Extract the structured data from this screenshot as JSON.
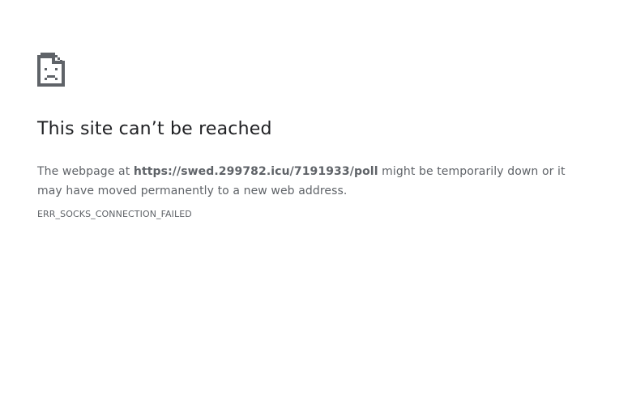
{
  "colors": {
    "title": "#202124",
    "body_text": "#5f6368",
    "icon": "#5f6368",
    "background": "#ffffff"
  },
  "icon": {
    "name": "sad-page-icon"
  },
  "error": {
    "title": "This site can’t be reached",
    "message_prefix": "The webpage at ",
    "url": "https://swed.299782.icu/7191933/poll",
    "message_suffix": " might be temporarily down or it may have moved permanently to a new web address.",
    "code": "ERR_SOCKS_CONNECTION_FAILED"
  }
}
